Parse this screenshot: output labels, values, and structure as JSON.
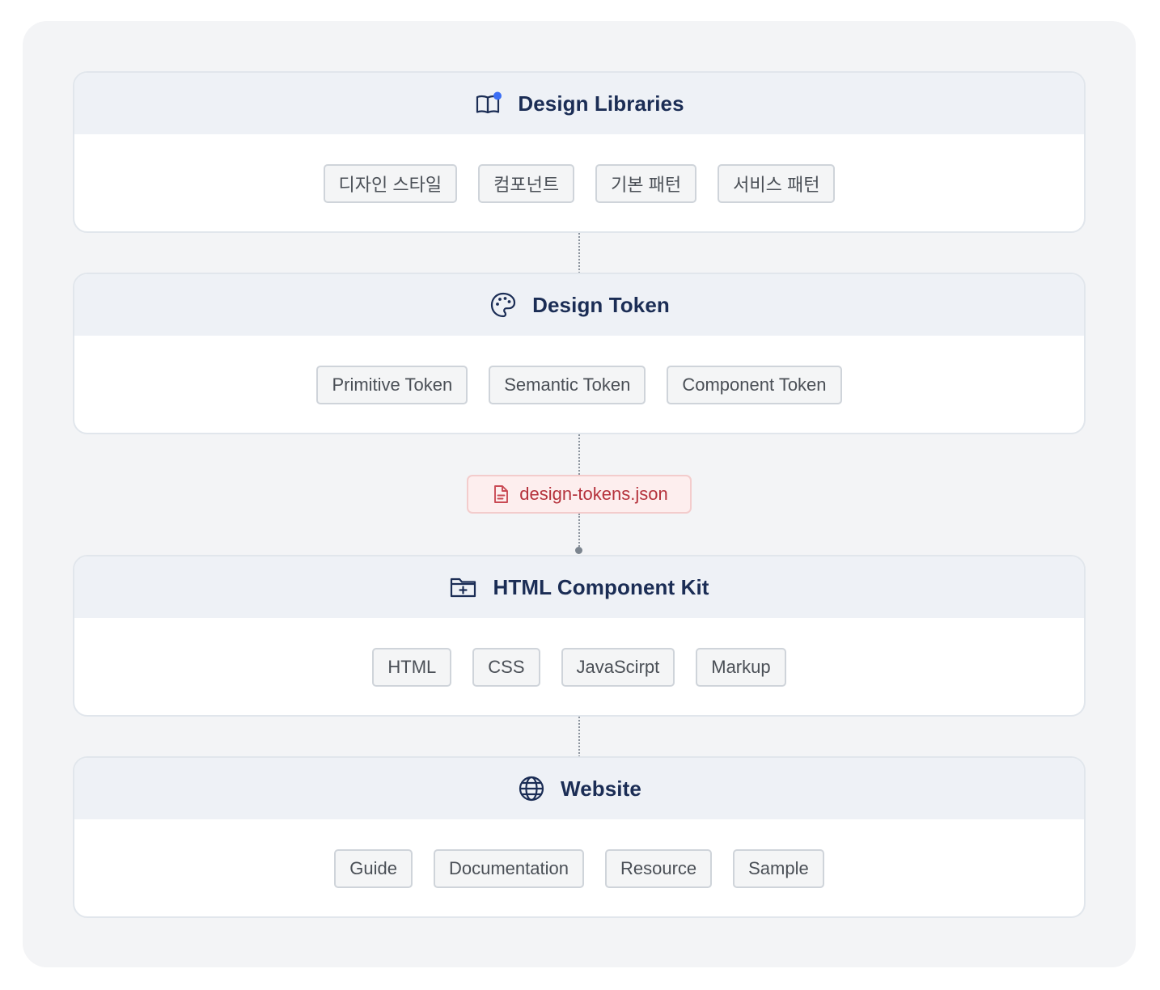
{
  "colors": {
    "title": "#1b2d55",
    "accent_dot": "#3b6ef5",
    "file_text": "#b5323c",
    "chip_border": "#cfd4da"
  },
  "layers": [
    {
      "title": "Design Libraries",
      "icon": "book-open-icon",
      "items": [
        "디자인 스타일",
        "컴포넌트",
        "기본 패턴",
        "서비스 패턴"
      ]
    },
    {
      "title": "Design Token",
      "icon": "palette-icon",
      "items": [
        "Primitive Token",
        "Semantic Token",
        "Component Token"
      ]
    },
    {
      "title": "HTML Component Kit",
      "icon": "folder-plus-icon",
      "items": [
        "HTML",
        "CSS",
        "JavaScirpt",
        "Markup"
      ]
    },
    {
      "title": "Website",
      "icon": "globe-icon",
      "items": [
        "Guide",
        "Documentation",
        "Resource",
        "Sample"
      ]
    }
  ],
  "file": {
    "label": "design-tokens.json",
    "icon": "file-text-icon"
  }
}
